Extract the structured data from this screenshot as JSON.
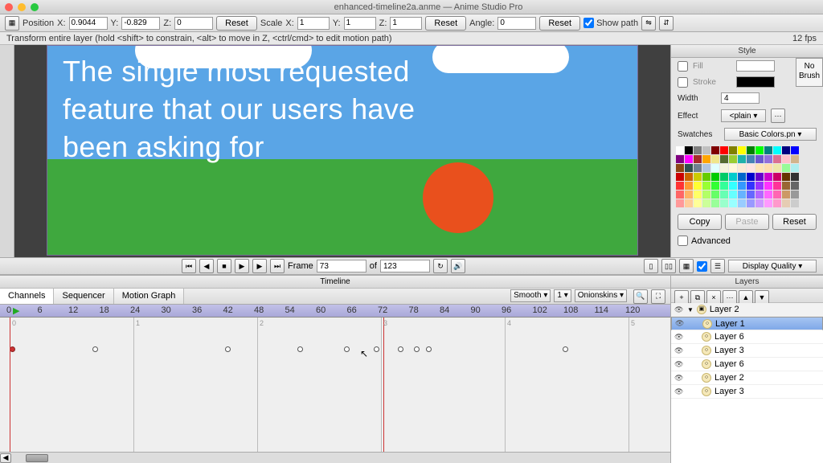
{
  "window": {
    "title": "enhanced-timeline2a.anme — Anime Studio Pro"
  },
  "transform": {
    "position_label": "Position",
    "x": "0.9044",
    "y": "-0.829",
    "z": "0",
    "reset": "Reset",
    "scale_label": "Scale",
    "sx": "1",
    "sy": "1",
    "sz": "1",
    "angle_label": "Angle:",
    "angle": "0",
    "showpath": "Show path",
    "x_lbl": "X:",
    "y_lbl": "Y:",
    "z_lbl": "Z:"
  },
  "hint": {
    "text": "Transform entire layer (hold <shift> to constrain, <alt> to move in Z, <ctrl/cmd> to edit motion path)",
    "fps": "12 fps"
  },
  "canvas": {
    "overlay_text": "The single most requested feature that our users have been asking for"
  },
  "style": {
    "title": "Style",
    "fill": "Fill",
    "stroke": "Stroke",
    "width_lbl": "Width",
    "width": "4",
    "effect_lbl": "Effect",
    "effect_val": "<plain ▾",
    "swatches_lbl": "Swatches",
    "swatches_val": "Basic Colors.pn ▾",
    "brush": "No Brush",
    "copy": "Copy",
    "paste": "Paste",
    "reset": "Reset",
    "advanced": "Advanced"
  },
  "playback": {
    "frame_lbl": "Frame",
    "frame": "73",
    "of": "of",
    "total": "123",
    "quality": "Display Quality ▾"
  },
  "timeline": {
    "title": "Timeline",
    "tabs": [
      "Channels",
      "Sequencer",
      "Motion Graph"
    ],
    "smooth": "Smooth ▾",
    "one": "1 ▾",
    "onion": "Onionskins ▾",
    "ruler": [
      "0",
      "6",
      "12",
      "18",
      "24",
      "30",
      "36",
      "42",
      "48",
      "54",
      "60",
      "66",
      "72",
      "78",
      "84",
      "90",
      "96",
      "102",
      "108",
      "114",
      "120"
    ]
  },
  "layers": {
    "title": "Layers",
    "items": [
      {
        "name": "Layer 2",
        "group": true
      },
      {
        "name": "Layer 1",
        "sel": true
      },
      {
        "name": "Layer 6"
      },
      {
        "name": "Layer 3"
      },
      {
        "name": "Layer 6"
      },
      {
        "name": "Layer 2"
      },
      {
        "name": "Layer 3"
      }
    ]
  },
  "swatch_colors": [
    "#ffffff",
    "#000000",
    "#7f7f7f",
    "#c0c0c0",
    "#800000",
    "#ff0000",
    "#808000",
    "#ffff00",
    "#008000",
    "#00ff00",
    "#008080",
    "#00ffff",
    "#000080",
    "#0000ff",
    "#800080",
    "#ff00ff",
    "#a52a2a",
    "#ffa500",
    "#f0e68c",
    "#556b2f",
    "#9acd32",
    "#20b2aa",
    "#4682b4",
    "#6a5acd",
    "#9370db",
    "#db7093",
    "#ffc0cb",
    "#d2b48c",
    "#8b4513",
    "#2f4f4f",
    "#708090",
    "#b0c4de",
    "#e0ffff",
    "#f5f5dc",
    "#fff8dc",
    "#faebd7",
    "#ffe4e1",
    "#ffe4b5",
    "#ffdead",
    "#eee8aa",
    "#98fb98",
    "#afeeee",
    "#cc0000",
    "#cc6600",
    "#cccc00",
    "#66cc00",
    "#00cc00",
    "#00cc66",
    "#00cccc",
    "#0066cc",
    "#0000cc",
    "#6600cc",
    "#cc00cc",
    "#cc0066",
    "#663300",
    "#333333",
    "#ff3333",
    "#ff9933",
    "#ffff33",
    "#99ff33",
    "#33ff33",
    "#33ff99",
    "#33ffff",
    "#3399ff",
    "#3333ff",
    "#9933ff",
    "#ff33ff",
    "#ff3399",
    "#996633",
    "#666666",
    "#ff6666",
    "#ffb366",
    "#ffff66",
    "#b3ff66",
    "#66ff66",
    "#66ffb3",
    "#66ffff",
    "#66b3ff",
    "#6666ff",
    "#b366ff",
    "#ff66ff",
    "#ff66b3",
    "#cc9966",
    "#999999",
    "#ff9999",
    "#ffcc99",
    "#ffff99",
    "#ccff99",
    "#99ff99",
    "#99ffcc",
    "#99ffff",
    "#99ccff",
    "#9999ff",
    "#cc99ff",
    "#ff99ff",
    "#ff99cc",
    "#e6ccb3",
    "#cccccc"
  ]
}
